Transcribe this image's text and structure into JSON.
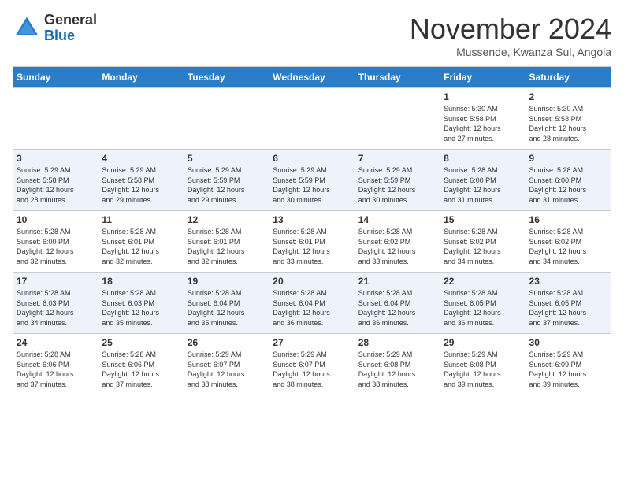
{
  "header": {
    "logo_line1": "General",
    "logo_line2": "Blue",
    "month": "November 2024",
    "location": "Mussende, Kwanza Sul, Angola"
  },
  "weekdays": [
    "Sunday",
    "Monday",
    "Tuesday",
    "Wednesday",
    "Thursday",
    "Friday",
    "Saturday"
  ],
  "weeks": [
    [
      {
        "day": "",
        "info": ""
      },
      {
        "day": "",
        "info": ""
      },
      {
        "day": "",
        "info": ""
      },
      {
        "day": "",
        "info": ""
      },
      {
        "day": "",
        "info": ""
      },
      {
        "day": "1",
        "info": "Sunrise: 5:30 AM\nSunset: 5:58 PM\nDaylight: 12 hours\nand 27 minutes."
      },
      {
        "day": "2",
        "info": "Sunrise: 5:30 AM\nSunset: 5:58 PM\nDaylight: 12 hours\nand 28 minutes."
      }
    ],
    [
      {
        "day": "3",
        "info": "Sunrise: 5:29 AM\nSunset: 5:58 PM\nDaylight: 12 hours\nand 28 minutes."
      },
      {
        "day": "4",
        "info": "Sunrise: 5:29 AM\nSunset: 5:58 PM\nDaylight: 12 hours\nand 29 minutes."
      },
      {
        "day": "5",
        "info": "Sunrise: 5:29 AM\nSunset: 5:59 PM\nDaylight: 12 hours\nand 29 minutes."
      },
      {
        "day": "6",
        "info": "Sunrise: 5:29 AM\nSunset: 5:59 PM\nDaylight: 12 hours\nand 30 minutes."
      },
      {
        "day": "7",
        "info": "Sunrise: 5:29 AM\nSunset: 5:59 PM\nDaylight: 12 hours\nand 30 minutes."
      },
      {
        "day": "8",
        "info": "Sunrise: 5:28 AM\nSunset: 6:00 PM\nDaylight: 12 hours\nand 31 minutes."
      },
      {
        "day": "9",
        "info": "Sunrise: 5:28 AM\nSunset: 6:00 PM\nDaylight: 12 hours\nand 31 minutes."
      }
    ],
    [
      {
        "day": "10",
        "info": "Sunrise: 5:28 AM\nSunset: 6:00 PM\nDaylight: 12 hours\nand 32 minutes."
      },
      {
        "day": "11",
        "info": "Sunrise: 5:28 AM\nSunset: 6:01 PM\nDaylight: 12 hours\nand 32 minutes."
      },
      {
        "day": "12",
        "info": "Sunrise: 5:28 AM\nSunset: 6:01 PM\nDaylight: 12 hours\nand 32 minutes."
      },
      {
        "day": "13",
        "info": "Sunrise: 5:28 AM\nSunset: 6:01 PM\nDaylight: 12 hours\nand 33 minutes."
      },
      {
        "day": "14",
        "info": "Sunrise: 5:28 AM\nSunset: 6:02 PM\nDaylight: 12 hours\nand 33 minutes."
      },
      {
        "day": "15",
        "info": "Sunrise: 5:28 AM\nSunset: 6:02 PM\nDaylight: 12 hours\nand 34 minutes."
      },
      {
        "day": "16",
        "info": "Sunrise: 5:28 AM\nSunset: 6:02 PM\nDaylight: 12 hours\nand 34 minutes."
      }
    ],
    [
      {
        "day": "17",
        "info": "Sunrise: 5:28 AM\nSunset: 6:03 PM\nDaylight: 12 hours\nand 34 minutes."
      },
      {
        "day": "18",
        "info": "Sunrise: 5:28 AM\nSunset: 6:03 PM\nDaylight: 12 hours\nand 35 minutes."
      },
      {
        "day": "19",
        "info": "Sunrise: 5:28 AM\nSunset: 6:04 PM\nDaylight: 12 hours\nand 35 minutes."
      },
      {
        "day": "20",
        "info": "Sunrise: 5:28 AM\nSunset: 6:04 PM\nDaylight: 12 hours\nand 36 minutes."
      },
      {
        "day": "21",
        "info": "Sunrise: 5:28 AM\nSunset: 6:04 PM\nDaylight: 12 hours\nand 36 minutes."
      },
      {
        "day": "22",
        "info": "Sunrise: 5:28 AM\nSunset: 6:05 PM\nDaylight: 12 hours\nand 36 minutes."
      },
      {
        "day": "23",
        "info": "Sunrise: 5:28 AM\nSunset: 6:05 PM\nDaylight: 12 hours\nand 37 minutes."
      }
    ],
    [
      {
        "day": "24",
        "info": "Sunrise: 5:28 AM\nSunset: 6:06 PM\nDaylight: 12 hours\nand 37 minutes."
      },
      {
        "day": "25",
        "info": "Sunrise: 5:28 AM\nSunset: 6:06 PM\nDaylight: 12 hours\nand 37 minutes."
      },
      {
        "day": "26",
        "info": "Sunrise: 5:29 AM\nSunset: 6:07 PM\nDaylight: 12 hours\nand 38 minutes."
      },
      {
        "day": "27",
        "info": "Sunrise: 5:29 AM\nSunset: 6:07 PM\nDaylight: 12 hours\nand 38 minutes."
      },
      {
        "day": "28",
        "info": "Sunrise: 5:29 AM\nSunset: 6:08 PM\nDaylight: 12 hours\nand 38 minutes."
      },
      {
        "day": "29",
        "info": "Sunrise: 5:29 AM\nSunset: 6:08 PM\nDaylight: 12 hours\nand 39 minutes."
      },
      {
        "day": "30",
        "info": "Sunrise: 5:29 AM\nSunset: 6:09 PM\nDaylight: 12 hours\nand 39 minutes."
      }
    ]
  ]
}
